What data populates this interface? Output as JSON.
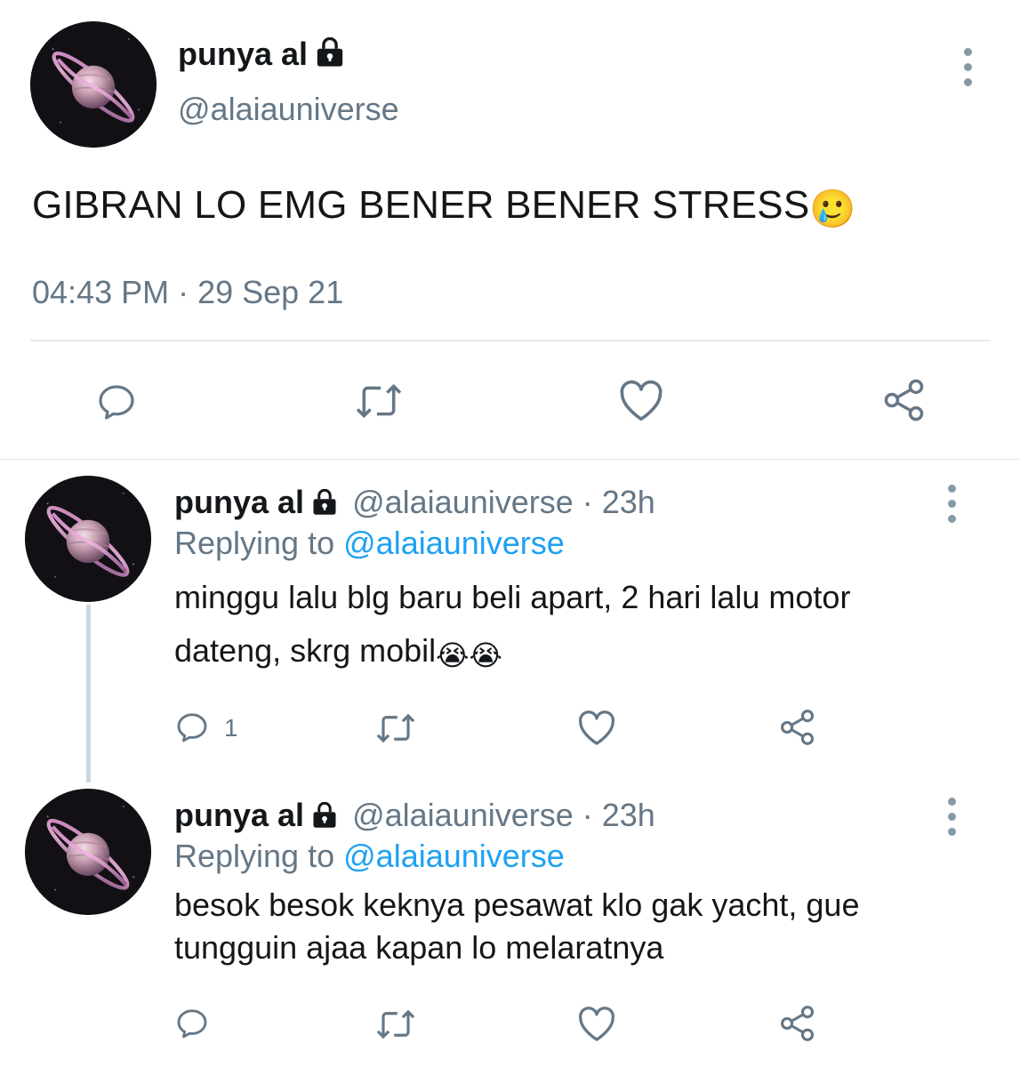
{
  "tweet": {
    "display_name": "punya al",
    "handle": "@alaiauniverse",
    "text": "GIBRAN LO EMG BENER BENER STRESS",
    "emoji": "🥲",
    "timestamp": "04:43 PM · 29 Sep 21",
    "actions": [
      "reply-icon",
      "retweet-icon",
      "like-icon",
      "share-icon"
    ]
  },
  "replies": [
    {
      "display_name": "punya al",
      "handle": "@alaiauniverse",
      "time": "· 23h",
      "replying_prefix": "Replying to",
      "replying_to": "@alaiauniverse",
      "text_line1": "minggu lalu blg baru beli apart, 2 hari lalu motor",
      "text_line2": "dateng, skrg mobil",
      "emoji": "😭😭",
      "reply_count": "1"
    },
    {
      "display_name": "punya al",
      "handle": "@alaiauniverse",
      "time": "· 23h",
      "replying_prefix": "Replying to",
      "replying_to": "@alaiauniverse",
      "text_line1": "besok besok keknya pesawat klo gak yacht, gue",
      "text_line2": "tungguin ajaa kapan lo melaratnya",
      "reply_count": ""
    }
  ],
  "colors": {
    "primary_text": "#14171a",
    "secondary_text": "#657786",
    "link": "#1da1f2",
    "icon": "#657786",
    "divider": "#e6ecf0"
  }
}
